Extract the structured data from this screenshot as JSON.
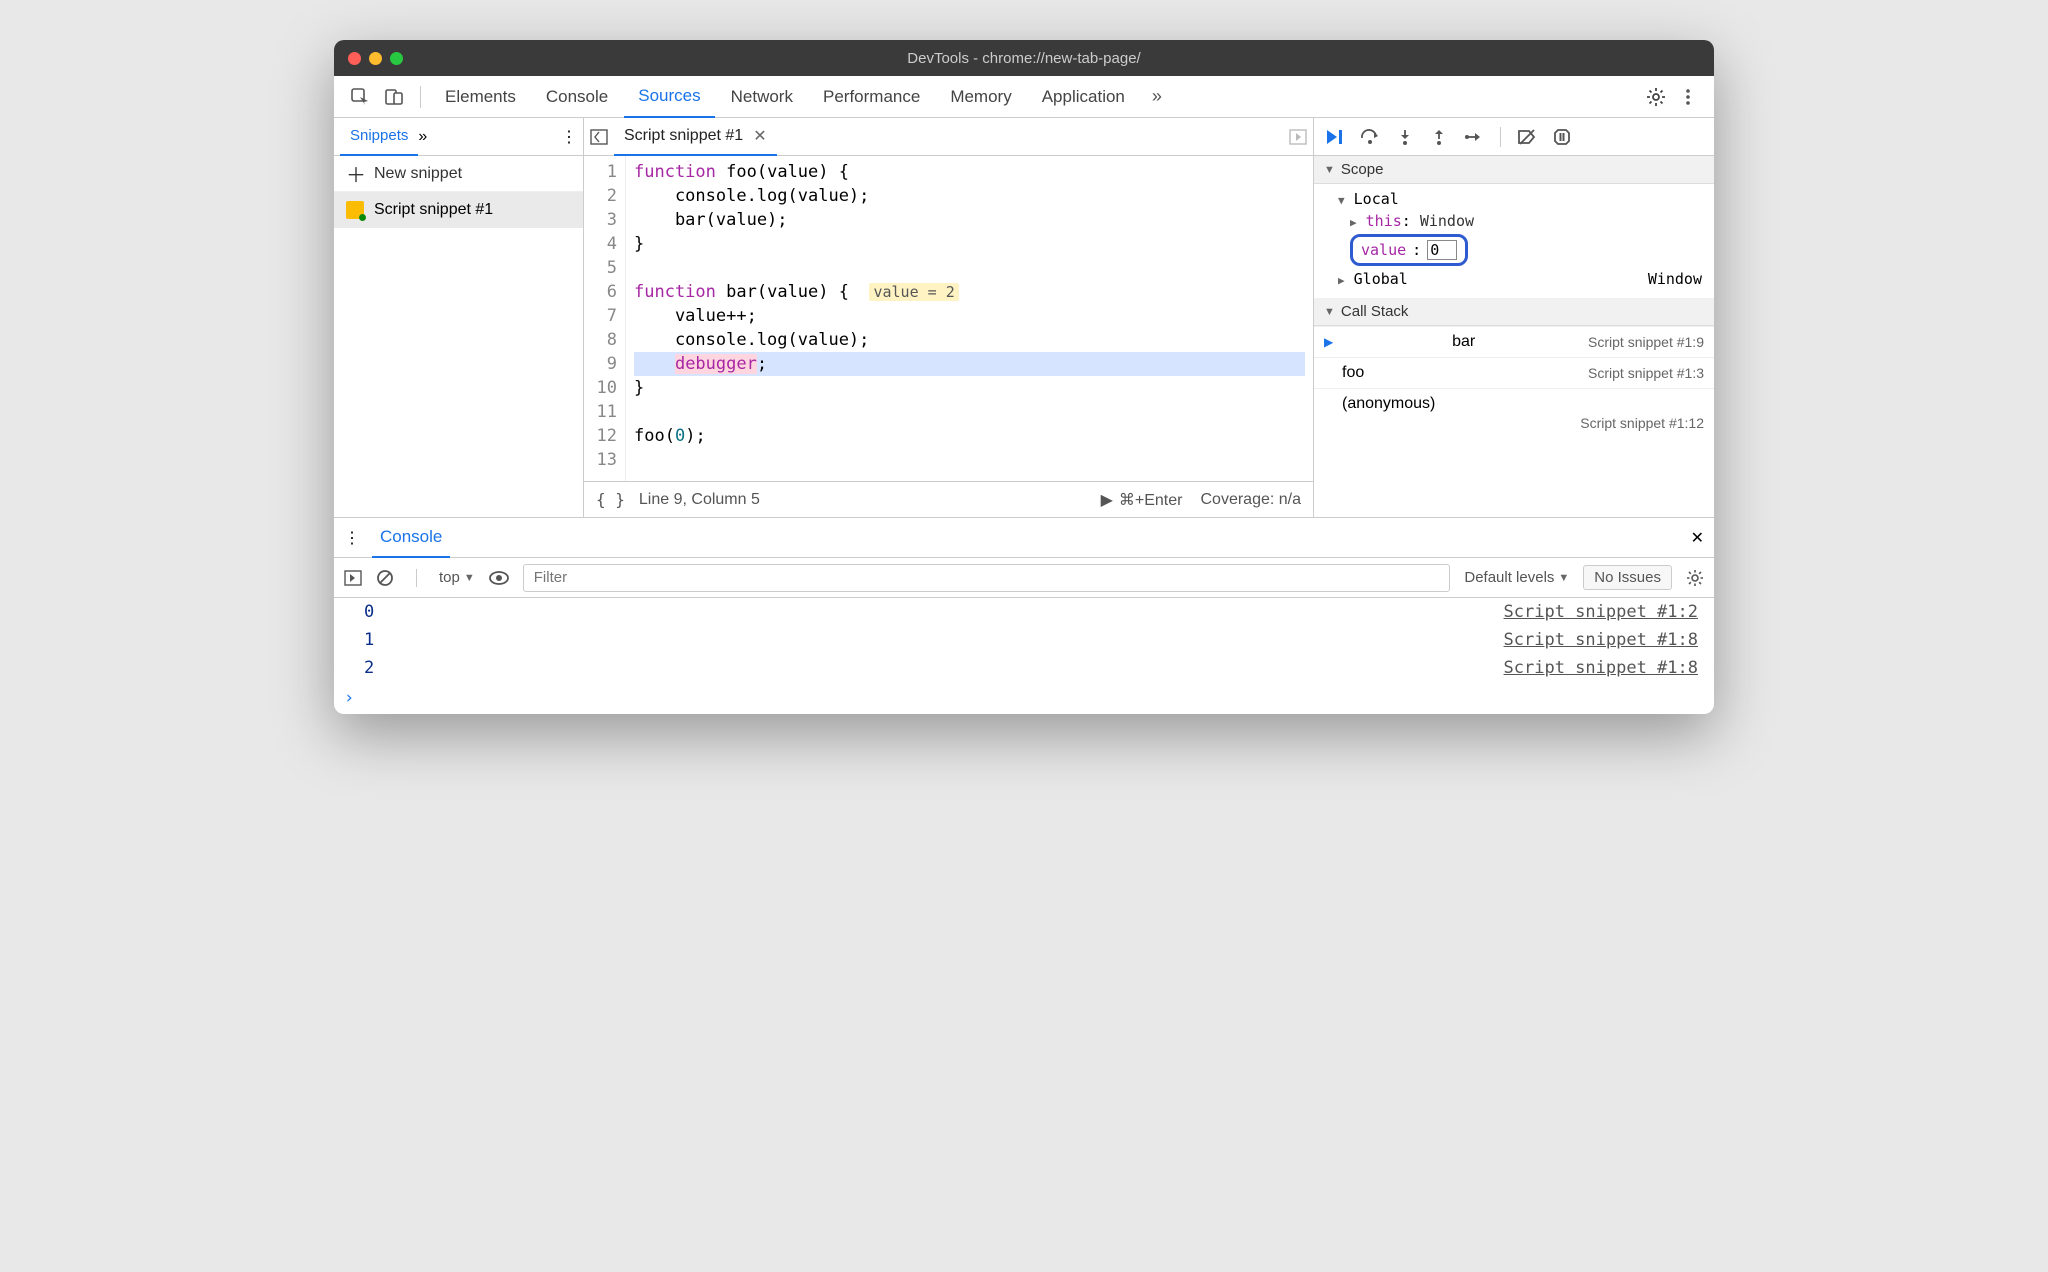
{
  "window": {
    "title": "DevTools - chrome://new-tab-page/"
  },
  "tabs": {
    "elements": "Elements",
    "console": "Console",
    "sources": "Sources",
    "network": "Network",
    "performance": "Performance",
    "memory": "Memory",
    "application": "Application"
  },
  "sidebar": {
    "tab": "Snippets",
    "new_snippet": "New snippet",
    "items": [
      {
        "label": "Script snippet #1"
      }
    ]
  },
  "editor": {
    "tab": "Script snippet #1",
    "code_lines": [
      "function foo(value) {",
      "    console.log(value);",
      "    bar(value);",
      "}",
      "",
      "function bar(value) {",
      "    value++;",
      "    console.log(value);",
      "    debugger;",
      "}",
      "",
      "foo(0);",
      ""
    ],
    "inline_hint": "value = 2",
    "status_line": "Line 9, Column 5",
    "run_hint": "⌘+Enter",
    "coverage": "Coverage: n/a"
  },
  "debugger": {
    "scope_header": "Scope",
    "local_header": "Local",
    "this_label": "this",
    "this_value": "Window",
    "value_label": "value",
    "value_edit": "0",
    "global_label": "Global",
    "global_value": "Window",
    "callstack_header": "Call Stack",
    "stack": [
      {
        "fn": "bar",
        "src": "Script snippet #1:9"
      },
      {
        "fn": "foo",
        "src": "Script snippet #1:3"
      }
    ],
    "anon_label": "(anonymous)",
    "anon_src": "Script snippet #1:12"
  },
  "console": {
    "tab": "Console",
    "context": "top",
    "filter_placeholder": "Filter",
    "levels": "Default levels",
    "no_issues": "No Issues",
    "logs": [
      {
        "value": "0",
        "src": "Script snippet #1:2"
      },
      {
        "value": "1",
        "src": "Script snippet #1:8"
      },
      {
        "value": "2",
        "src": "Script snippet #1:8"
      }
    ]
  }
}
